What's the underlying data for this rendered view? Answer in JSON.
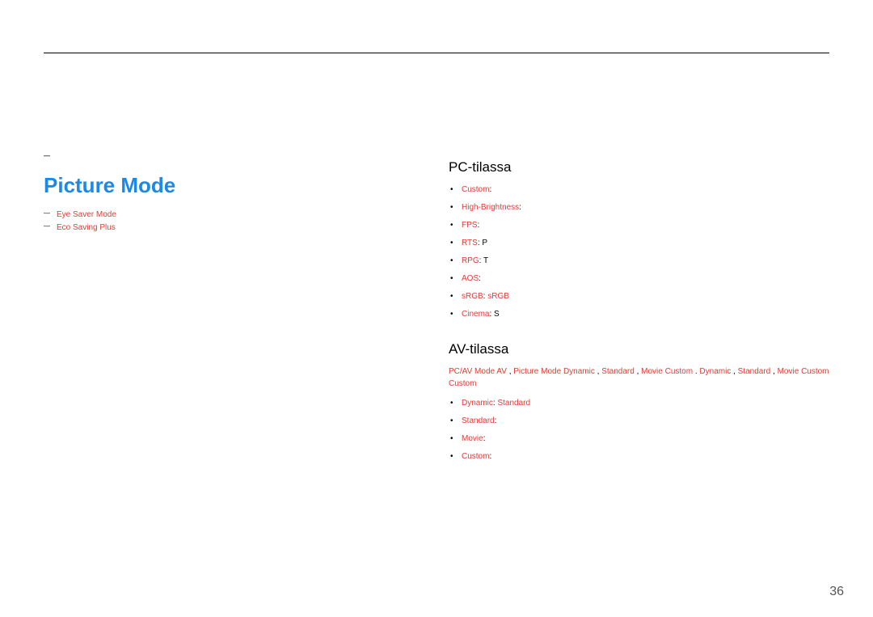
{
  "page_number": "36",
  "left": {
    "chapter_title": "",
    "notes1": [
      "",
      "",
      ""
    ],
    "picture_mode_heading": "Picture Mode",
    "picture_mode_desc": "",
    "pm_notes": [
      {
        "pre": " ",
        "red": "Eye Saver Mode",
        "post": " "
      },
      {
        "pre": " ",
        "red": "Eco Saving Plus",
        "post": " "
      }
    ]
  },
  "right": {
    "pc_heading": "PC-tilassa",
    "pc_items": [
      {
        "red": "Custom",
        "rest": ": "
      },
      {
        "red": "High-Brightness",
        "rest": ": "
      },
      {
        "red": "FPS",
        "rest": ":  ",
        "line2": ""
      },
      {
        "red": "RTS",
        "rest": ": P "
      },
      {
        "red": "RPG",
        "rest": ": T "
      },
      {
        "red": "AOS",
        "rest": ": "
      },
      {
        "txt1": "",
        "red": "sRGB",
        "txt2": ":  ",
        "red2": "sRGB",
        "txt3": " "
      },
      {
        "red": "Cinema",
        "rest": ": S "
      }
    ],
    "av_heading": "AV-tilassa",
    "av_para_parts": {
      "t1": " ",
      "pcav": "PC/AV Mode",
      "t2": "  ",
      "av": "AV",
      "t3": " , ",
      "pm": "Picture Mode",
      "t4": " ",
      "dyn": "Dynamic",
      "t5": ", ",
      "std": "Standard",
      "t6": ", ",
      "mov": "Movie",
      "t7": "  ",
      "cst": "Custom",
      "t8": ". ",
      "dyn2": "Dynamic",
      "t9": " , ",
      "std2": "Standard",
      "t10": ", ",
      "mov2": "Movie",
      "t11": "  ",
      "cst2": "Custom",
      "t12": "  ",
      "cst3": "Custom",
      "t13": " "
    },
    "av_items": [
      {
        "red": "Dynamic",
        "rest": ":  ",
        "trail_red": "Standard",
        "trail": " "
      },
      {
        "red": "Standard",
        "rest": ": "
      },
      {
        "red": "Movie",
        "rest": ":  ",
        "line2": " "
      },
      {
        "red": "Custom",
        "rest": ": "
      }
    ]
  }
}
